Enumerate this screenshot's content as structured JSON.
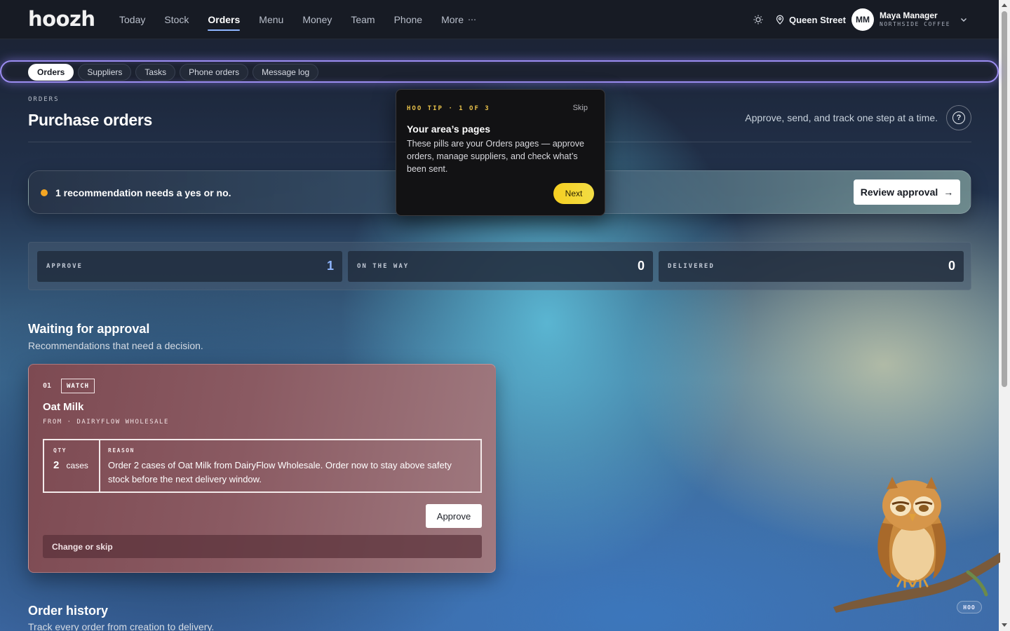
{
  "app": {
    "logo": "hoozh"
  },
  "nav": {
    "items": [
      {
        "label": "Today",
        "active": false
      },
      {
        "label": "Stock",
        "active": false
      },
      {
        "label": "Orders",
        "active": true
      },
      {
        "label": "Menu",
        "active": false
      },
      {
        "label": "Money",
        "active": false
      },
      {
        "label": "Team",
        "active": false
      },
      {
        "label": "Phone",
        "active": false
      },
      {
        "label": "More",
        "active": false
      }
    ],
    "more_glyph": "⋯"
  },
  "header_right": {
    "theme_icon": "sun-icon",
    "location": "Queen Street",
    "avatar_initials": "MM",
    "user_name": "Maya Manager",
    "user_org": "NORTHSIDE COFFEE"
  },
  "subnav": {
    "pills": [
      {
        "label": "Orders",
        "active": true
      },
      {
        "label": "Suppliers",
        "active": false
      },
      {
        "label": "Tasks",
        "active": false
      },
      {
        "label": "Phone orders",
        "active": false
      },
      {
        "label": "Message log",
        "active": false
      }
    ]
  },
  "page": {
    "eyebrow": "ORDERS",
    "title": "Purchase orders",
    "subtitle": "Approve, send, and track one step at a time.",
    "help_glyph": "?"
  },
  "banner": {
    "text": "1 recommendation needs a yes or no.",
    "button": "Review approval",
    "status_color": "#f5a623"
  },
  "stats": [
    {
      "label": "APPROVE",
      "value": "1"
    },
    {
      "label": "ON THE WAY",
      "value": "0"
    },
    {
      "label": "DELIVERED",
      "value": "0"
    }
  ],
  "waiting": {
    "title": "Waiting for approval",
    "subtitle": "Recommendations that need a decision.",
    "cards": [
      {
        "index": "01",
        "tag": "WATCH",
        "title": "Oat Milk",
        "from": "FROM · DAIRYFLOW WHOLESALE",
        "qty_label": "QTY",
        "qty_value": "2",
        "qty_unit": "cases",
        "reason_label": "REASON",
        "reason": "Order 2 cases of Oat Milk from DairyFlow Wholesale. Order now to stay above safety stock before the next delivery window.",
        "approve": "Approve",
        "change": "Change or skip"
      }
    ]
  },
  "history": {
    "title": "Order history",
    "subtitle": "Track every order from creation to delivery."
  },
  "tip": {
    "eyebrow": "HOO TIP · 1 OF 3",
    "skip": "Skip",
    "title": "Your area’s pages",
    "body": "These pills are your Orders pages — approve orders, manage suppliers, and check what’s been sent.",
    "next": "Next"
  },
  "mascot": {
    "badge": "HOO"
  },
  "colors": {
    "accent": "#8fb6ff",
    "highlight": "#9b8cf0",
    "tip_yellow": "#f6cf21"
  }
}
